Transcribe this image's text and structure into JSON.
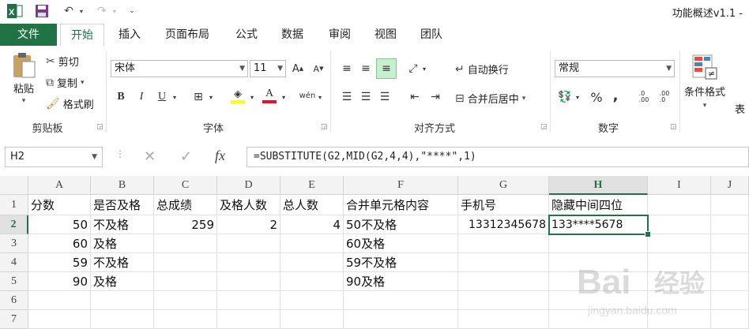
{
  "titlebar": {
    "app_title": "功能概述v1.1 -"
  },
  "tabs": [
    {
      "label": "文件"
    },
    {
      "label": "开始"
    },
    {
      "label": "插入"
    },
    {
      "label": "页面布局"
    },
    {
      "label": "公式"
    },
    {
      "label": "数据"
    },
    {
      "label": "审阅"
    },
    {
      "label": "视图"
    },
    {
      "label": "团队"
    }
  ],
  "ribbon": {
    "clipboard": {
      "paste": "粘贴",
      "cut": "剪切",
      "copy": "复制",
      "format_painter": "格式刷",
      "label": "剪贴板"
    },
    "font": {
      "name": "宋体",
      "size": "11",
      "bold": "B",
      "italic": "I",
      "underline": "U",
      "label": "字体"
    },
    "alignment": {
      "wrap_text": "自动换行",
      "merge_center": "合并后居中",
      "label": "对齐方式"
    },
    "number": {
      "format": "常规",
      "percent": "%",
      "comma": ",",
      "label": "数字"
    },
    "styles": {
      "conditional_format": "条件格式",
      "table_partial": "表"
    }
  },
  "formula_bar": {
    "name_box": "H2",
    "formula": "=SUBSTITUTE(G2,MID(G2,4,4),\"****\",1)",
    "fx": "fx"
  },
  "sheet": {
    "columns": [
      "A",
      "B",
      "C",
      "D",
      "E",
      "F",
      "G",
      "H",
      "I",
      "J"
    ],
    "rows": [
      "1",
      "2",
      "3",
      "4",
      "5",
      "6",
      "7"
    ],
    "cells": {
      "r1": [
        "分数",
        "是否及格",
        "总成绩",
        "及格人数",
        "总人数",
        "合并单元格内容",
        "手机号",
        "隐藏中间四位",
        "",
        ""
      ],
      "r2": [
        "50",
        "不及格",
        "259",
        "2",
        "4",
        "50不及格",
        "13312345678",
        "133****5678",
        "",
        ""
      ],
      "r3": [
        "60",
        "及格",
        "",
        "",
        "",
        "60及格",
        "",
        "",
        "",
        ""
      ],
      "r4": [
        "59",
        "不及格",
        "",
        "",
        "",
        "59不及格",
        "",
        "",
        "",
        ""
      ],
      "r5": [
        "90",
        "及格",
        "",
        "",
        "",
        "90及格",
        "",
        "",
        "",
        ""
      ],
      "r6": [
        "",
        "",
        "",
        "",
        "",
        "",
        "",
        "",
        "",
        ""
      ],
      "r7": [
        "",
        "",
        "",
        "",
        "",
        "",
        "",
        "",
        "",
        ""
      ]
    },
    "selected_cell": "H2"
  },
  "watermark": {
    "text1": "Bai",
    "text2": "经验",
    "url": "jingyan.baidu.com"
  },
  "colors": {
    "accent": "#217346",
    "highlight_fill": "#c6efce"
  }
}
